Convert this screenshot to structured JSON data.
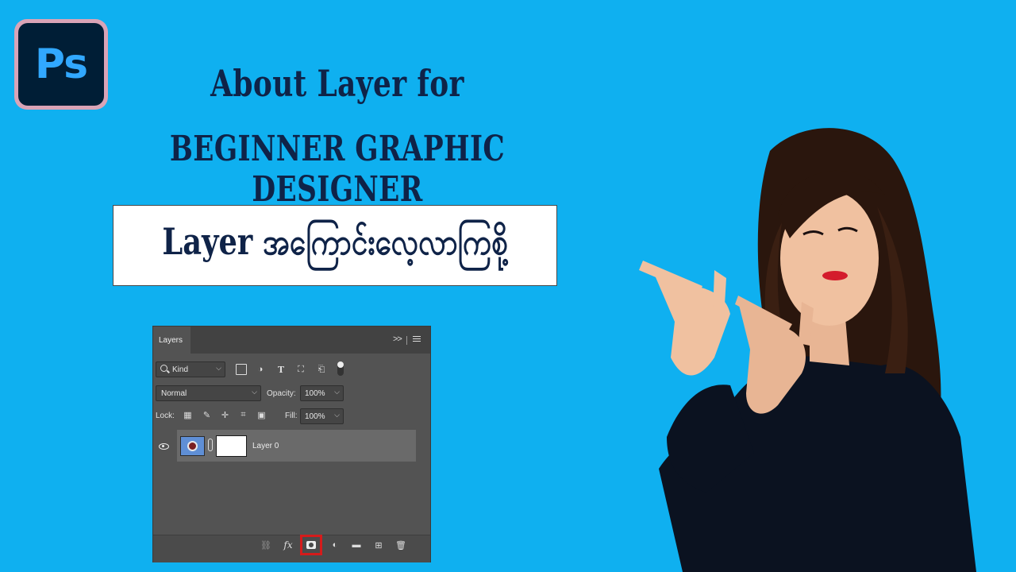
{
  "logo": {
    "text": "Ps"
  },
  "title": {
    "line1": "About Layer for",
    "line2": "BEGINNER GRAPHIC DESIGNER"
  },
  "banner": {
    "text": "Layer အကြောင်းလေ့လာကြစို့"
  },
  "layers_panel": {
    "tab_label": "Layers",
    "filter_kind": "Kind",
    "filter_icons": [
      "image-filter-icon",
      "adjustment-filter-icon",
      "type-filter-icon",
      "shape-filter-icon",
      "smart-object-filter-icon"
    ],
    "blend_mode": "Normal",
    "opacity_label": "Opacity:",
    "opacity_value": "100%",
    "lock_label": "Lock:",
    "lock_icons": [
      "lock-transparent-icon",
      "lock-image-icon",
      "lock-position-icon",
      "lock-artboard-icon",
      "lock-all-icon"
    ],
    "fill_label": "Fill:",
    "fill_value": "100%",
    "layers": [
      {
        "name": "Layer 0",
        "visible": true,
        "has_mask": true
      }
    ],
    "bottom_icons": [
      "link-layers-icon",
      "fx-icon",
      "add-mask-icon",
      "adjustment-layer-icon",
      "group-folder-icon",
      "new-layer-icon",
      "trash-icon"
    ],
    "highlighted_button": "add-mask-icon",
    "highlight_color": "#d61b1b"
  },
  "colors": {
    "background": "#0fb0f0",
    "title": "#0f2348",
    "ps_blue": "#31a8ff",
    "ps_dark": "#001e36"
  }
}
